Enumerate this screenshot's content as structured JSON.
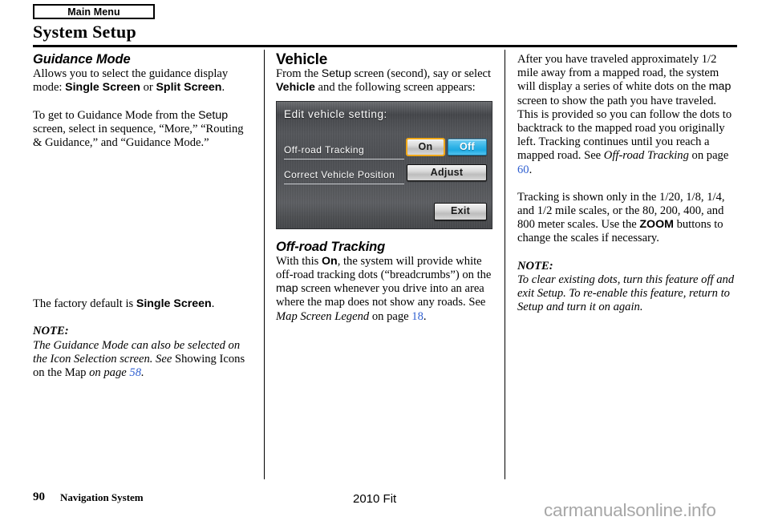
{
  "header": {
    "tab_label": "Main Menu",
    "title": "System Setup"
  },
  "left_column": {
    "section_title": "Guidance Mode",
    "p1_a": "Allows you to select the guidance display mode: ",
    "p1_b": "Single Screen",
    "p1_c": " or ",
    "p1_d": "Split Screen",
    "p1_e": ".",
    "p2_a": "To get to Guidance Mode from the ",
    "p2_b": "Setup",
    "p2_c": " screen, select in sequence, “More,” “Routing & Guidance,” and “Guidance Mode.”",
    "p3_a": "The factory default is ",
    "p3_b": "Single Screen",
    "p3_c": ".",
    "note_head": "NOTE:",
    "note_a": "The Guidance Mode can also be selected on the Icon Selection screen. ",
    "note_see": "See",
    "note_b": " Showing Icons on the Map ",
    "note_c": "on page ",
    "note_page": "58",
    "note_d": "."
  },
  "middle_column": {
    "section_title": "Vehicle",
    "p1_a": "From the ",
    "p1_b": "Setup",
    "p1_c": " screen (second), say or select ",
    "p1_d": "Vehicle",
    "p1_e": " and the following screen appears:",
    "nav_screen": {
      "title": "Edit vehicle setting:",
      "row1_label": "Off-road Tracking",
      "row1_button_on": "On",
      "row1_button_off": "Off",
      "row2_label": "Correct Vehicle Position",
      "row2_button": "Adjust",
      "exit_button": "Exit",
      "selected_highlight_color": "#f0a818",
      "active_state_color": "#1da9e2"
    },
    "section2_title": "Off-road Tracking",
    "p2_a": "With this ",
    "p2_b": "On",
    "p2_c": ", the system will provide white off-road tracking dots (“breadcrumbs”) on the ",
    "p2_d": "map",
    "p2_e": " screen whenever you drive into an area where the map does not show any roads. See ",
    "p2_f": "Map Screen Legend",
    "p2_g": " on page ",
    "p2_page": "18",
    "p2_h": "."
  },
  "right_column": {
    "p1_a": "After you have traveled approximately 1/2 mile away from a mapped road, the system will display a series of white dots on the ",
    "p1_b": "map",
    "p1_c": " screen to show the path you have traveled. This is provided so you can follow the dots to backtrack to the mapped road you originally left. Tracking continues until you reach a mapped road. See ",
    "p1_d": "Off-road Tracking",
    "p1_e": " on page ",
    "p1_page": "60",
    "p1_f": ".",
    "p2_a": "Tracking is shown only in the 1/20, 1/8, 1/4, and 1/2 mile scales, or the 80, 200, 400, and 800 meter scales. Use the ",
    "p2_b": "ZOOM",
    "p2_c": " buttons to change the scales if necessary.",
    "note_head": "NOTE:",
    "note_a": "To clear existing dots, turn this feature off and exit Setup. To re-enable this feature, return to Setup and turn it on again."
  },
  "footer": {
    "page_number": "90",
    "section_name": "Navigation System",
    "model": "2010 Fit",
    "watermark": "carmanualsonline.info"
  }
}
